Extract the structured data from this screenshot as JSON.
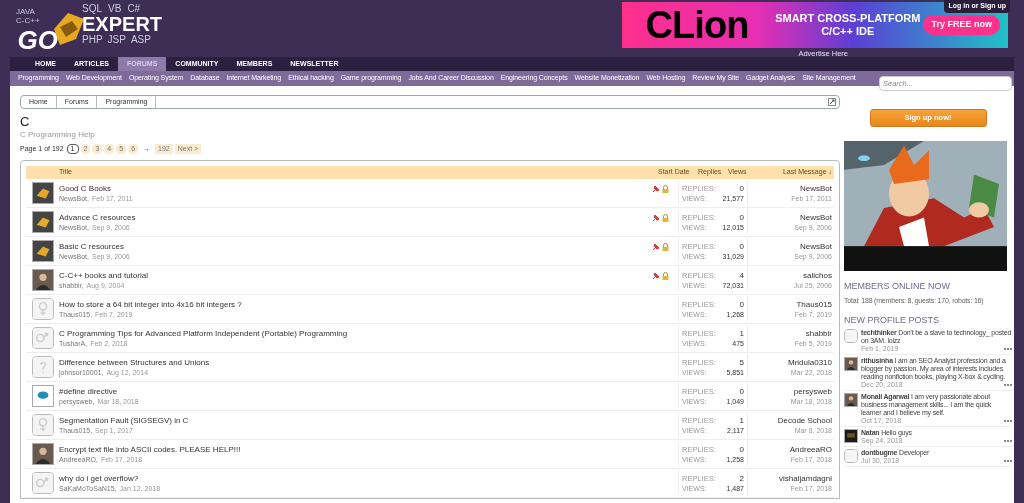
{
  "logo": {
    "name": "EXPERT",
    "prefix": "GO",
    "languages": [
      "JAVA",
      "C-C++",
      "SQL",
      "VB",
      "C#",
      "PHP",
      "JSP",
      "ASP"
    ]
  },
  "ad": {
    "product": "CLion",
    "headline": "SMART CROSS-PLATFORM",
    "subline": "C/C++ IDE",
    "cta": "Try FREE now",
    "note": "Advertise Here"
  },
  "login": "Log in or Sign up",
  "tabs": [
    {
      "label": "HOME",
      "selected": false
    },
    {
      "label": "ARTICLES",
      "selected": false
    },
    {
      "label": "FORUMS",
      "selected": true
    },
    {
      "label": "COMMUNITY",
      "selected": false
    },
    {
      "label": "MEMBERS",
      "selected": false
    },
    {
      "label": "NEWSLETTER",
      "selected": false
    }
  ],
  "subnav": [
    "Programming",
    "Web Development",
    "Operating System",
    "Database",
    "Internet Marketing",
    "Ethical hacking",
    "Game programming",
    "Jobs And Career Discussion",
    "Engineering Concepts",
    "Website Monetization",
    "Web Hosting",
    "Review My Site",
    "Gadget Analysis",
    "Site Management"
  ],
  "search": {
    "placeholder": "Search..."
  },
  "breadcrumb": [
    "Home",
    "Forums",
    "Programming"
  ],
  "title": "C",
  "subtitle": "C Programming Help",
  "pagination": {
    "summary": "Page 1 of 192",
    "pages": [
      {
        "label": "1",
        "selected": true
      },
      {
        "label": "2",
        "selected": false
      },
      {
        "label": "3",
        "selected": false
      },
      {
        "label": "4",
        "selected": false
      },
      {
        "label": "5",
        "selected": false
      },
      {
        "label": "6",
        "selected": false
      }
    ],
    "arrow": "→",
    "last": "192",
    "next": "Next >"
  },
  "table": {
    "columns": [
      "Title",
      "Start Date",
      "Replies",
      "Views",
      "Last Message ↓"
    ],
    "rows": [
      {
        "avatar": {
          "kind": "logo"
        },
        "title": "Good C Books",
        "author": "NewsBot,",
        "date": "Feb 17, 2011",
        "sticky": true,
        "locked": true,
        "replies_label": "REPLIES:",
        "replies": "0",
        "views_label": "VIEWS:",
        "views": "21,577",
        "last_user": "NewsBot",
        "last_date": "Feb 17, 2011"
      },
      {
        "avatar": {
          "kind": "logo"
        },
        "title": "Advance C resources",
        "author": "NewsBot,",
        "date": "Sep 9, 2006",
        "sticky": true,
        "locked": true,
        "replies_label": "REPLIES:",
        "replies": "0",
        "views_label": "VIEWS:",
        "views": "12,015",
        "last_user": "NewsBot",
        "last_date": "Sep 9, 2006"
      },
      {
        "avatar": {
          "kind": "logo"
        },
        "title": "Basic C resources",
        "author": "NewsBot,",
        "date": "Sep 9, 2006",
        "sticky": true,
        "locked": true,
        "replies_label": "REPLIES:",
        "replies": "0",
        "views_label": "VIEWS:",
        "views": "31,029",
        "last_user": "NewsBot",
        "last_date": "Sep 9, 2006"
      },
      {
        "avatar": {
          "kind": "person"
        },
        "title": "C-C++ books and tutorial",
        "author": "shabbir,",
        "date": "Aug 9, 2004",
        "sticky": true,
        "locked": true,
        "replies_label": "REPLIES:",
        "replies": "4",
        "views_label": "VIEWS:",
        "views": "72,031",
        "last_user": "salichos",
        "last_date": "Jul 25, 2006"
      },
      {
        "avatar": {
          "kind": "female"
        },
        "title": "How to store a 64 bit integer into 4x16 bit integers ?",
        "author": "Thaus015,",
        "date": "Feb 7, 2019",
        "sticky": false,
        "locked": false,
        "replies_label": "REPLIES:",
        "replies": "0",
        "views_label": "VIEWS:",
        "views": "1,268",
        "last_user": "Thaus015",
        "last_date": "Feb 7, 2019"
      },
      {
        "avatar": {
          "kind": "male"
        },
        "title": "C Programming Tips for Advanced Platform Independent (Portable) Programming",
        "author": "TusharA,",
        "date": "Feb 2, 2018",
        "sticky": false,
        "locked": false,
        "replies_label": "REPLIES:",
        "replies": "1",
        "views_label": "VIEWS:",
        "views": "475",
        "last_user": "shabbir",
        "last_date": "Feb 5, 2019"
      },
      {
        "avatar": {
          "kind": "unknown"
        },
        "title": "Difference between Structures and Unions",
        "author": "johnsor10001,",
        "date": "Aug 12, 2014",
        "sticky": false,
        "locked": false,
        "replies_label": "REPLIES:",
        "replies": "5",
        "views_label": "VIEWS:",
        "views": "5,851",
        "last_user": "Mridula0310",
        "last_date": "Mar 22, 2018"
      },
      {
        "avatar": {
          "kind": "site"
        },
        "title": "#define directive",
        "author": "persysweb,",
        "date": "Mar 18, 2018",
        "sticky": false,
        "locked": false,
        "replies_label": "REPLIES:",
        "replies": "0",
        "views_label": "VIEWS:",
        "views": "1,049",
        "last_user": "persysweb",
        "last_date": "Mar 18, 2018"
      },
      {
        "avatar": {
          "kind": "female"
        },
        "title": "Segmentation Fault (SIGSEGV) in C",
        "author": "Thaus015,",
        "date": "Sep 1, 2017",
        "sticky": false,
        "locked": false,
        "replies_label": "REPLIES:",
        "replies": "1",
        "views_label": "VIEWS:",
        "views": "2,117",
        "last_user": "Decode School",
        "last_date": "Mar 8, 2018"
      },
      {
        "avatar": {
          "kind": "person"
        },
        "title": "Encrypt text file into ASCII codes. PLEASE HELP!!!",
        "author": "AndreeaRO,",
        "date": "Feb 17, 2018",
        "sticky": false,
        "locked": false,
        "replies_label": "REPLIES:",
        "replies": "0",
        "views_label": "VIEWS:",
        "views": "1,258",
        "last_user": "AndreeaRO",
        "last_date": "Feb 17, 2018"
      },
      {
        "avatar": {
          "kind": "male"
        },
        "title": "why do i get overflow?",
        "author": "SaKaMoToSaN15,",
        "date": "Jan 12, 2018",
        "sticky": false,
        "locked": false,
        "replies_label": "REPLIES:",
        "replies": "2",
        "views_label": "VIEWS:",
        "views": "1,487",
        "last_user": "vishaljamdagni",
        "last_date": "Feb 17, 2018"
      }
    ]
  },
  "sidebar": {
    "signup": "Sign up now!",
    "members_online": {
      "heading": "MEMBERS ONLINE NOW",
      "total": "Total: 188 (members: 8, guests: 170, robots: 16)"
    },
    "profile_posts": {
      "heading": "NEW PROFILE POSTS",
      "posts": [
        {
          "avatar": {
            "kind": "blank"
          },
          "text": "**techthinker** Don't be a slave to technology_ posted on 3AM. lolzz",
          "date": "Feb 1, 2019"
        },
        {
          "avatar": {
            "kind": "person"
          },
          "text": "**rithusinha** I am an SEO Analyst profession and a blogger by passion. My area of interests includes reading nonfiction books, playing X-box & cycling.",
          "date": "Dec 20, 2018"
        },
        {
          "avatar": {
            "kind": "person"
          },
          "text": "**Monali Agarwal** I am very passionate about business management skills... I am the quick learner and I believe my self.",
          "date": "Oct 17, 2018"
        },
        {
          "avatar": {
            "kind": "dark"
          },
          "text": "**Natan** Hello guys",
          "date": "Sep 24, 2018"
        },
        {
          "avatar": {
            "kind": "blank"
          },
          "text": "**dontbugme** Developer",
          "date": "Jul 30, 2018"
        }
      ]
    }
  }
}
